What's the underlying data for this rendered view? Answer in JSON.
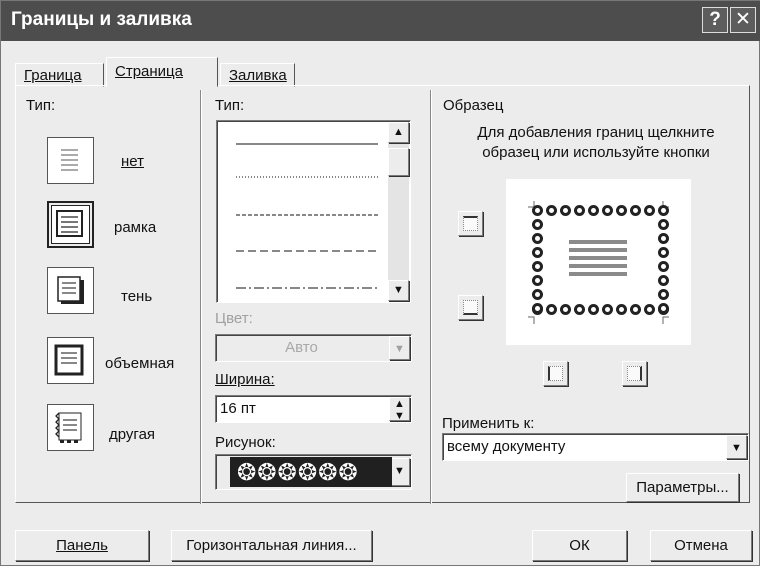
{
  "window": {
    "title": "Границы и заливка",
    "help_icon": "?",
    "close_icon": "✕"
  },
  "tabs": [
    {
      "label": "Граница"
    },
    {
      "label": "Страница"
    },
    {
      "label": "Заливка"
    }
  ],
  "setting": {
    "label": "Тип:",
    "items": [
      {
        "label": "нет"
      },
      {
        "label": "рамка"
      },
      {
        "label": "тень"
      },
      {
        "label": "объемная"
      },
      {
        "label": "другая"
      }
    ]
  },
  "style": {
    "label": "Тип:",
    "color_label": "Цвет:",
    "color_value": "Авто",
    "width_label": "Ширина:",
    "width_value": "16 пт",
    "art_label": "Рисунок:",
    "art_value": "❂❂❂❂❂❂"
  },
  "preview": {
    "heading": "Образец",
    "instruction": "Для добавления границ щелкните образец или используйте кнопки",
    "apply_label": "Применить к:",
    "apply_value": "всему документу",
    "options_button": "Параметры..."
  },
  "buttons": {
    "panel": "Панель",
    "horizontal_line": "Горизонтальная линия...",
    "ok": "ОК",
    "cancel": "Отмена"
  }
}
